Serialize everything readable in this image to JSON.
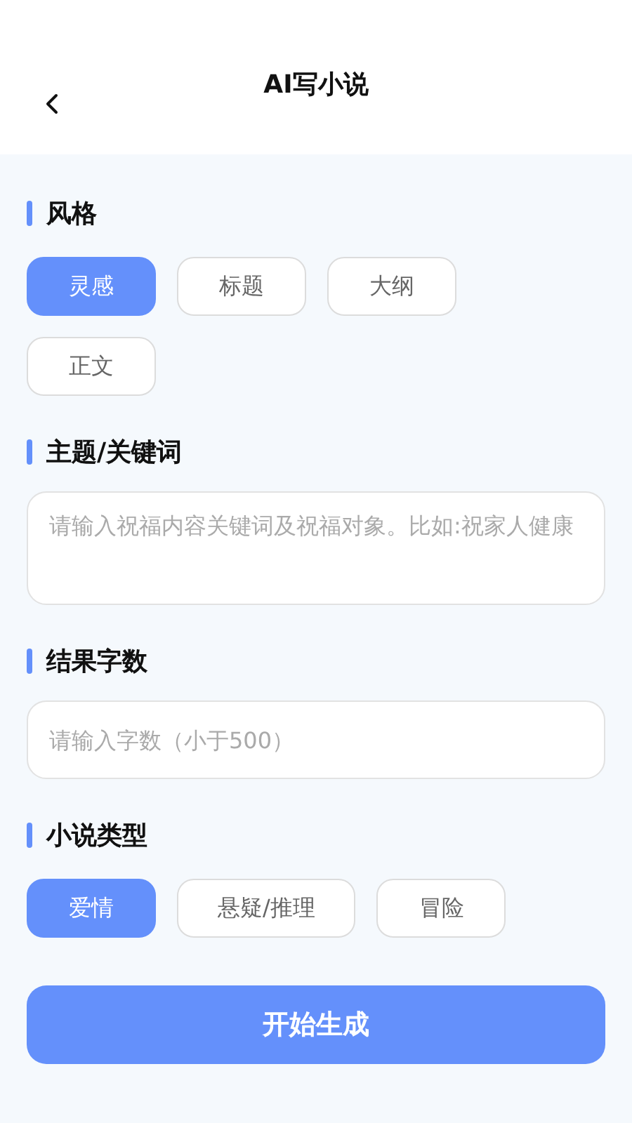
{
  "header": {
    "title": "AI写小说"
  },
  "sections": [
    {
      "kind": "chips",
      "title": "风格",
      "options": [
        {
          "label": "灵感",
          "selected": true
        },
        {
          "label": "标题",
          "selected": false
        },
        {
          "label": "大纲",
          "selected": false
        },
        {
          "label": "正文",
          "selected": false
        }
      ]
    },
    {
      "kind": "textarea",
      "title": "主题/关键词",
      "placeholder": "请输入祝福内容关键词及祝福对象。比如:祝家人健康"
    },
    {
      "kind": "input",
      "title": "结果字数",
      "placeholder": "请输入字数（小于500）"
    },
    {
      "kind": "chips",
      "title": "小说类型",
      "options": [
        {
          "label": "爱情",
          "selected": true
        },
        {
          "label": "悬疑/推理",
          "selected": false
        },
        {
          "label": "冒险",
          "selected": false
        }
      ]
    }
  ],
  "action_button": "开始生成"
}
